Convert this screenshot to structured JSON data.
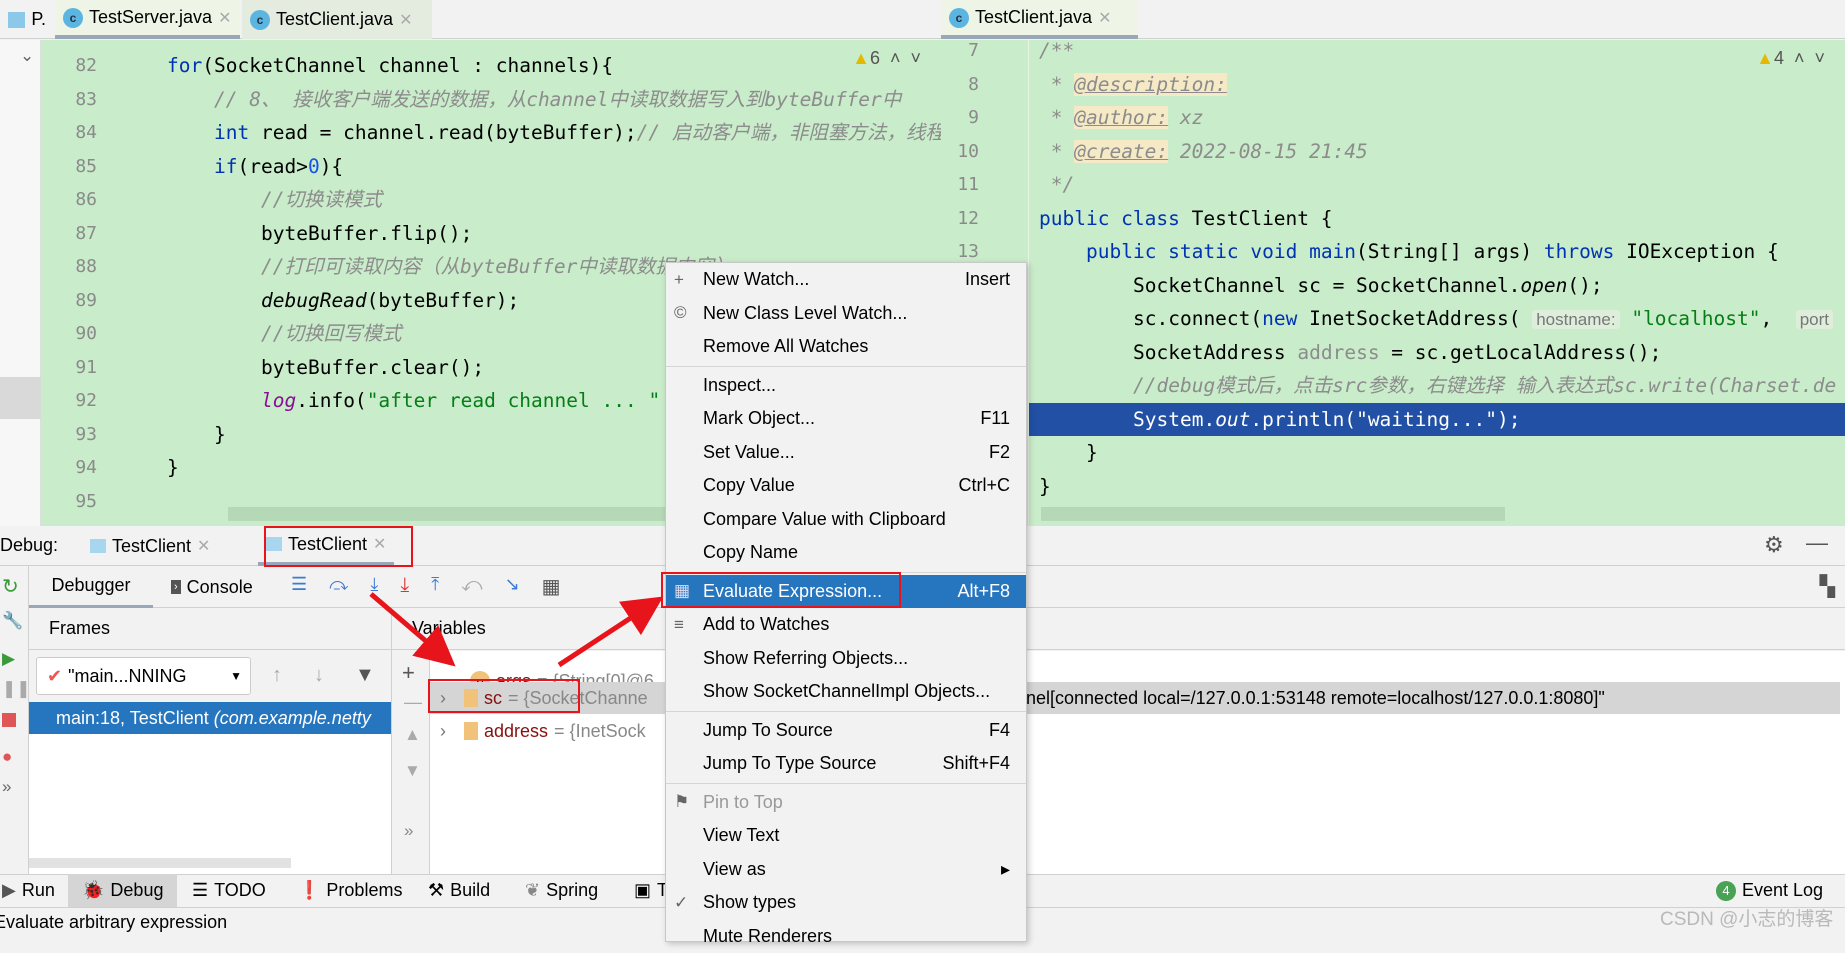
{
  "tabs_left": [
    {
      "label": "P."
    },
    {
      "label": "TestServer.java"
    },
    {
      "label": "TestClient.java"
    }
  ],
  "tab_right": {
    "label": "TestClient.java"
  },
  "left_editor": {
    "warnings": "6",
    "lines": [
      {
        "n": "82",
        "indent": 0,
        "tokens": [
          [
            "kw",
            "for"
          ],
          [
            "",
            "(SocketChannel channel : channels){"
          ]
        ]
      },
      {
        "n": "83",
        "indent": 4,
        "tokens": [
          [
            "cm",
            "// 8、 接收客户端发送的数据，从channel中读取数据写入到byteBuffer中"
          ]
        ]
      },
      {
        "n": "84",
        "indent": 4,
        "tokens": [
          [
            "kw",
            "int"
          ],
          [
            "",
            " read = channel.read(byteBuffer);"
          ],
          [
            "cm",
            "// 启动客户端，非阻塞方法，线程"
          ]
        ]
      },
      {
        "n": "85",
        "indent": 4,
        "tokens": [
          [
            "kw",
            "if"
          ],
          [
            "",
            "(read>"
          ],
          [
            "num",
            "0"
          ],
          [
            "",
            "){"
          ]
        ]
      },
      {
        "n": "86",
        "indent": 8,
        "tokens": [
          [
            "cm",
            "//切换读模式"
          ]
        ]
      },
      {
        "n": "87",
        "indent": 8,
        "tokens": [
          [
            "",
            "byteBuffer.flip();"
          ]
        ]
      },
      {
        "n": "88",
        "indent": 8,
        "tokens": [
          [
            "cm",
            "//打印可读取内容（从byteBuffer中读取数据内容）"
          ]
        ]
      },
      {
        "n": "89",
        "indent": 8,
        "tokens": [
          [
            "it",
            "debugRead"
          ],
          [
            "",
            "(byteBuffer);"
          ]
        ]
      },
      {
        "n": "90",
        "indent": 8,
        "tokens": [
          [
            "cm",
            "//切换回写模式"
          ]
        ]
      },
      {
        "n": "91",
        "indent": 8,
        "tokens": [
          [
            "",
            "byteBuffer.clear();"
          ]
        ]
      },
      {
        "n": "92",
        "indent": 8,
        "tokens": [
          [
            "pur",
            "log"
          ],
          [
            "",
            ".info("
          ],
          [
            "str",
            "\"after read channel ... \""
          ]
        ]
      },
      {
        "n": "93",
        "indent": 4,
        "tokens": [
          [
            "",
            "}"
          ]
        ]
      },
      {
        "n": "94",
        "indent": 0,
        "tokens": [
          [
            "",
            "}"
          ]
        ]
      },
      {
        "n": "95",
        "indent": 0,
        "tokens": []
      }
    ]
  },
  "right_editor": {
    "warnings": "4",
    "lines": [
      {
        "n": "7",
        "indent": 0,
        "tokens": [
          [
            "cm",
            "/**"
          ]
        ]
      },
      {
        "n": "8",
        "indent": 1,
        "tokens": [
          [
            "cm",
            "* "
          ],
          [
            "tag",
            "@description:"
          ]
        ]
      },
      {
        "n": "9",
        "indent": 1,
        "tokens": [
          [
            "cm",
            "* "
          ],
          [
            "tag",
            "@author:"
          ],
          [
            "cm",
            " xz"
          ]
        ]
      },
      {
        "n": "10",
        "indent": 1,
        "tokens": [
          [
            "cm",
            "* "
          ],
          [
            "tag",
            "@create:"
          ],
          [
            "cm",
            " 2022-08-15 21:45"
          ]
        ]
      },
      {
        "n": "11",
        "indent": 1,
        "tokens": [
          [
            "cm",
            "*/"
          ]
        ]
      },
      {
        "n": "12",
        "indent": 0,
        "tokens": [
          [
            "kw",
            "public class"
          ],
          [
            "",
            " TestClient {"
          ]
        ]
      },
      {
        "n": "13",
        "indent": 4,
        "tokens": [
          [
            "kw",
            "public static void"
          ],
          [
            "",
            " "
          ],
          [
            "kw",
            "main"
          ],
          [
            "",
            "(String[] args) "
          ],
          [
            "kw",
            "throws"
          ],
          [
            "",
            " IOException {"
          ]
        ]
      },
      {
        "n": "",
        "indent": 8,
        "tokens": [
          [
            "",
            "SocketChannel sc = SocketChannel."
          ],
          [
            "it",
            "open"
          ],
          [
            "",
            "();"
          ]
        ]
      },
      {
        "n": "",
        "indent": 8,
        "tokens": [
          [
            "",
            "sc.connect("
          ],
          [
            "kw",
            "new"
          ],
          [
            "",
            " InetSocketAddress( "
          ],
          [
            "hint",
            "hostname:"
          ],
          [
            "",
            " "
          ],
          [
            "str",
            "\"localhost\""
          ],
          [
            "",
            ",  "
          ],
          [
            "hint",
            "port"
          ]
        ]
      },
      {
        "n": "",
        "indent": 8,
        "tokens": [
          [
            "",
            "SocketAddress "
          ],
          [
            "gray",
            "address"
          ],
          [
            "",
            " = sc.getLocalAddress();"
          ]
        ]
      },
      {
        "n": "",
        "indent": 8,
        "tokens": [
          [
            "cm",
            "//debug模式后，点击src参数，右键选择 输入表达式sc.write(Charset.de"
          ]
        ]
      },
      {
        "n": "",
        "indent": 8,
        "hl": true,
        "tokens": [
          [
            "",
            "System."
          ],
          [
            "it",
            "out"
          ],
          [
            "",
            ".println(\"waiting...\");"
          ]
        ]
      },
      {
        "n": "",
        "indent": 4,
        "tokens": [
          [
            "",
            "}"
          ]
        ]
      },
      {
        "n": "",
        "indent": 0,
        "tokens": [
          [
            "",
            "}"
          ]
        ]
      }
    ]
  },
  "debug": {
    "label": "Debug:",
    "tabs": [
      "TestClient",
      "TestClient"
    ],
    "subtabs": [
      "Debugger",
      "Console"
    ],
    "frames_header": "Frames",
    "thread": "\"main...NNING",
    "frame": "main:18, TestClient",
    "frame_pkg": "(com.example.netty",
    "variables_header": "Variables",
    "vars": [
      {
        "badge": "p",
        "name": "args",
        "value": "= {String[0]@6"
      },
      {
        "name": "sc",
        "value": "= {SocketChanne"
      },
      {
        "name": "address",
        "value": "= {InetSock"
      }
    ],
    "sc_value_tail": "nel[connected local=/127.0.0.1:53148 remote=localhost/127.0.0.1:8080]\""
  },
  "menu": [
    {
      "label": "New Watch...",
      "shortcut": "Insert",
      "icon": "+"
    },
    {
      "label": "New Class Level Watch...",
      "icon": "©"
    },
    {
      "label": "Remove All Watches"
    },
    {
      "sep": true
    },
    {
      "label": "Inspect..."
    },
    {
      "label": "Mark Object...",
      "shortcut": "F11"
    },
    {
      "label": "Set Value...",
      "shortcut": "F2"
    },
    {
      "label": "Copy Value",
      "shortcut": "Ctrl+C"
    },
    {
      "label": "Compare Value with Clipboard"
    },
    {
      "label": "Copy Name"
    },
    {
      "sep": true
    },
    {
      "label": "Evaluate Expression...",
      "shortcut": "Alt+F8",
      "icon": "▦",
      "selected": true
    },
    {
      "label": "Add to Watches",
      "icon": "≡"
    },
    {
      "label": "Show Referring Objects..."
    },
    {
      "label": "Show SocketChannelImpl Objects..."
    },
    {
      "sep": true
    },
    {
      "label": "Jump To Source",
      "shortcut": "F4"
    },
    {
      "label": "Jump To Type Source",
      "shortcut": "Shift+F4"
    },
    {
      "sep": true
    },
    {
      "label": "Pin to Top",
      "icon": "⚑",
      "disabled": true
    },
    {
      "label": "View Text"
    },
    {
      "label": "View as",
      "shortcut": "▸"
    },
    {
      "label": "Show types",
      "icon": "✓"
    },
    {
      "label": "Mute Renderers"
    }
  ],
  "bottom_tools": [
    "Run",
    "Debug",
    "TODO",
    "Problems",
    "Build",
    "Spring",
    "T"
  ],
  "event_log": {
    "count": "4",
    "label": "Event Log"
  },
  "status": "Evaluate arbitrary expression",
  "watermark": "CSDN @小志的博客",
  "colors": {
    "editor_bg": "#c9ecca",
    "selection": "#2675bf",
    "annotation": "#e8141c"
  }
}
